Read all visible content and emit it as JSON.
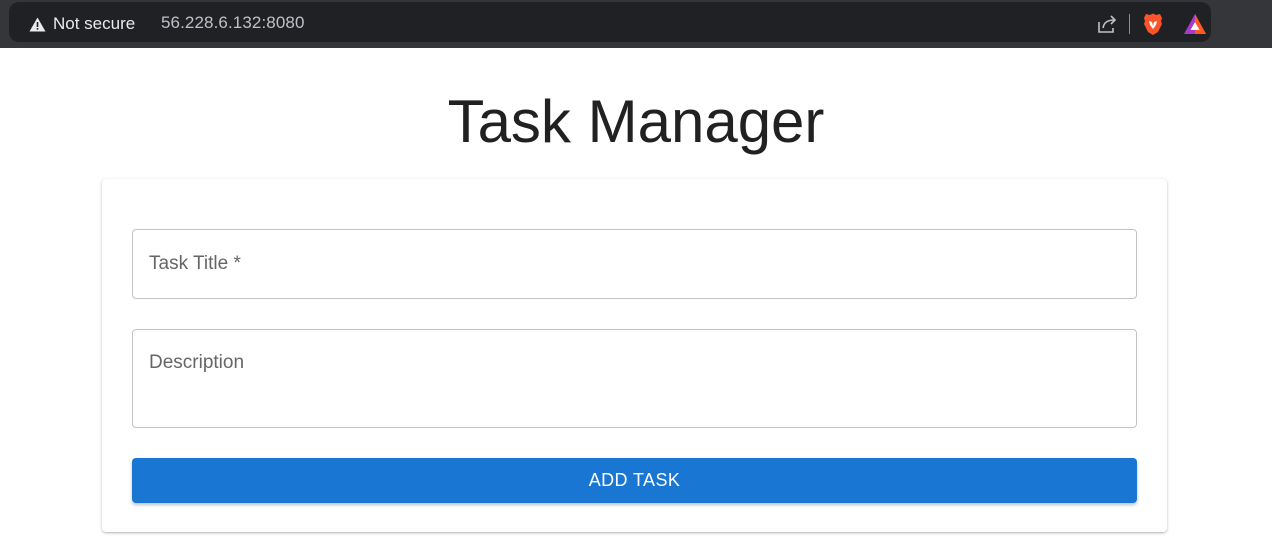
{
  "browser": {
    "security_label": "Not secure",
    "url": "56.228.6.132:8080",
    "icons": [
      "warning-icon",
      "share-icon",
      "brave-shield-icon",
      "brave-rewards-icon"
    ],
    "colors": {
      "bar": "#35363a",
      "omnibox": "#202124",
      "text": "#e8eaed"
    }
  },
  "page": {
    "title": "Task Manager"
  },
  "form": {
    "title_placeholder": "Task Title *",
    "title_value": "",
    "description_placeholder": "Description",
    "description_value": "",
    "submit_label": "ADD TASK"
  },
  "colors": {
    "accent": "#1976d2",
    "title_text": "#212121",
    "field_border": "#c4c4c4"
  }
}
